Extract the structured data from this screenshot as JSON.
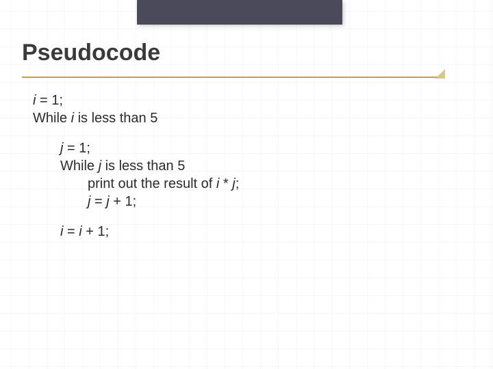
{
  "heading": "Pseudocode",
  "lines": {
    "l1_a": "i",
    "l1_b": " = 1;",
    "l2_a": "While ",
    "l2_b": "i",
    "l2_c": " is less than 5",
    "l3_a": "j",
    "l3_b": " = 1;",
    "l4_a": "While ",
    "l4_b": "j",
    "l4_c": " is less than 5",
    "l5_a": "print out the result of ",
    "l5_b": "i",
    "l5_c": " * ",
    "l5_d": "j",
    "l5_e": ";",
    "l6_a": "j",
    "l6_b": " = ",
    "l6_c": "j",
    "l6_d": " + 1;",
    "l7_a": "i",
    "l7_b": " = ",
    "l7_c": "i",
    "l7_d": " + 1;"
  }
}
